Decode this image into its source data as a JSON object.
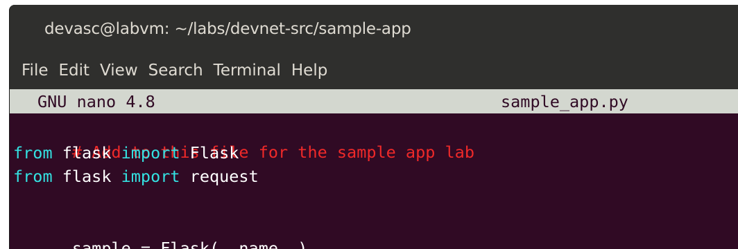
{
  "window": {
    "title": "devasc@labvm: ~/labs/devnet-src/sample-app"
  },
  "menubar": {
    "items": [
      "File",
      "Edit",
      "View",
      "Search",
      "Terminal",
      "Help"
    ]
  },
  "nano": {
    "version_label": "GNU nano 4.8",
    "filename": "sample_app.py"
  },
  "code": {
    "line1": "# Add to this file for the sample app lab",
    "line2_kw1": "from",
    "line2_mid": " flask ",
    "line2_kw2": "import",
    "line2_tail": " Flask",
    "line3_kw1": "from",
    "line3_mid": " flask ",
    "line3_kw2": "import",
    "line3_tail": " request",
    "line5": "sample = Flask(__name__)"
  },
  "colors": {
    "terminal_bg": "#300a24",
    "comment": "#ef2929",
    "keyword": "#34e2e2",
    "nano_bar_bg": "#d3d7cf",
    "titlebar_bg": "#2f2f2d"
  }
}
